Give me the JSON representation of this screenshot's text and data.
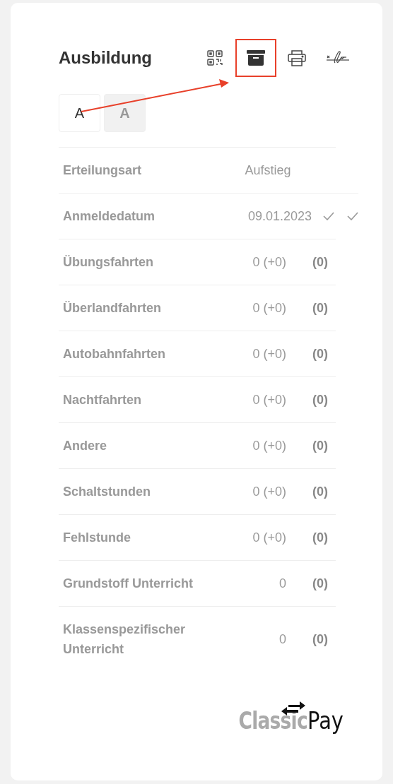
{
  "title": "Ausbildung",
  "toolbar": [
    {
      "kind": "qr",
      "highlighted": false
    },
    {
      "kind": "archive",
      "highlighted": true
    },
    {
      "kind": "print",
      "highlighted": false
    },
    {
      "kind": "signature",
      "highlighted": false
    }
  ],
  "tabs": [
    {
      "label": "A",
      "selected": true
    },
    {
      "label": "A",
      "selected": false
    }
  ],
  "rows": [
    {
      "kind": "value",
      "label": "Erteilungsart",
      "value": "Aufstieg"
    },
    {
      "kind": "confirmed",
      "label": "Anmeldedatum",
      "value": "09.01.2023"
    },
    {
      "kind": "count",
      "label": "Übungsfahrten",
      "value": "0 (+0)",
      "total": "(0)"
    },
    {
      "kind": "count",
      "label": "Überlandfahrten",
      "value": "0 (+0)",
      "total": "(0)"
    },
    {
      "kind": "count",
      "label": "Autobahnfahrten",
      "value": "0 (+0)",
      "total": "(0)"
    },
    {
      "kind": "count",
      "label": "Nachtfahrten",
      "value": "0 (+0)",
      "total": "(0)"
    },
    {
      "kind": "count",
      "label": "Andere",
      "value": "0 (+0)",
      "total": "(0)"
    },
    {
      "kind": "count",
      "label": "Schaltstunden",
      "value": "0 (+0)",
      "total": "(0)"
    },
    {
      "kind": "count",
      "label": "Fehlstunde",
      "value": "0 (+0)",
      "total": "(0)"
    },
    {
      "kind": "count",
      "label": "Grundstoff Unterricht",
      "value": "0",
      "total": "(0)"
    },
    {
      "kind": "count",
      "label": "Klassenspezifischer Unterricht",
      "value": "0",
      "total": "(0)"
    }
  ],
  "logo": {
    "first": "Classic",
    "second": "Pay"
  }
}
